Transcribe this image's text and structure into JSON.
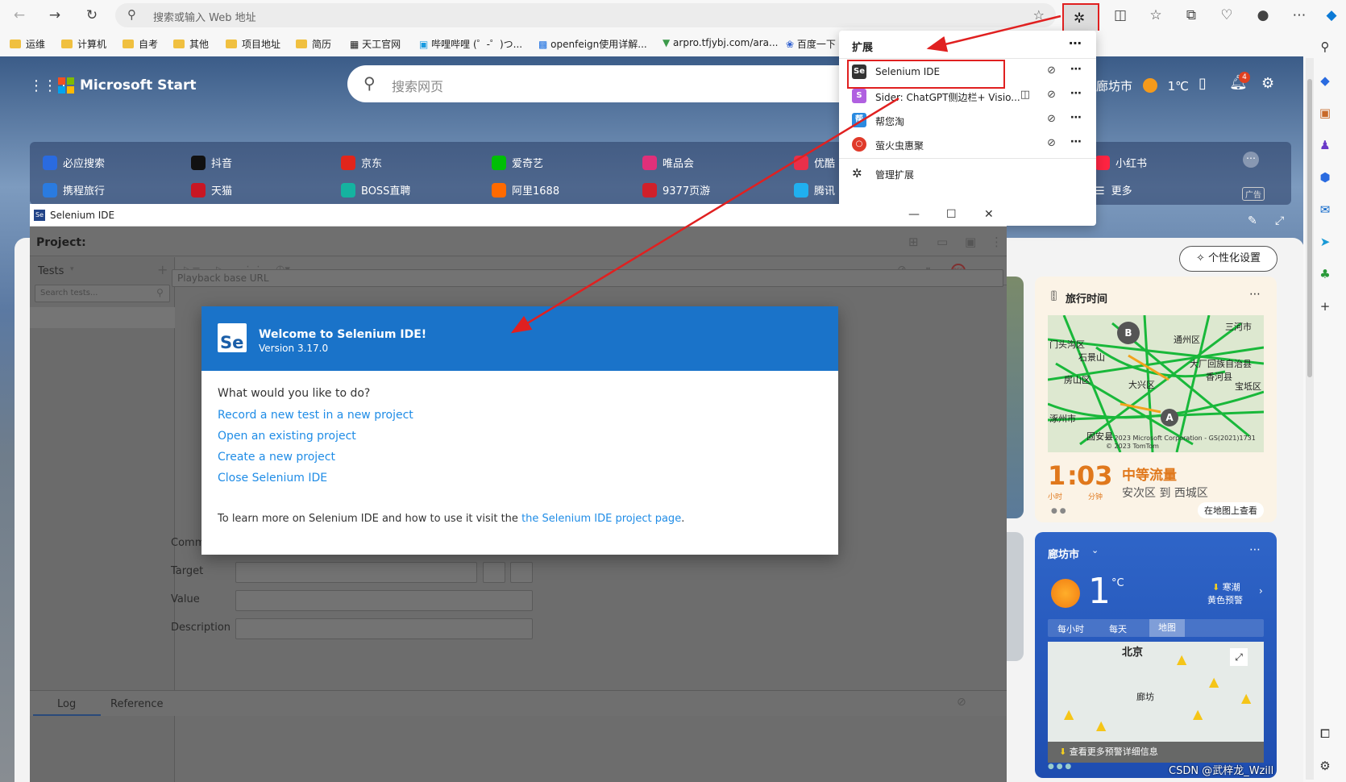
{
  "browser": {
    "address_placeholder": "搜索或输入 Web 地址",
    "bookmarks": [
      "运维",
      "计算机",
      "自考",
      "其他",
      "项目地址",
      "简历",
      "天工官网",
      "哔哩哔哩 (゜-゜)つ...",
      "openfeign使用详解...",
      "arpro.tfjybj.com/ara...",
      "百度一下"
    ],
    "page_title_logo": "Microsoft Start",
    "page_search_placeholder": "搜索网页",
    "location_text": "廊坊市",
    "temp_top": "1℃",
    "notif_count": "4"
  },
  "quick_links": {
    "row1": [
      "必应搜索",
      "抖音",
      "京东",
      "爱奇艺",
      "唯品会",
      "优酷",
      "小红书"
    ],
    "row2": [
      "携程旅行",
      "天猫",
      "BOSS直聘",
      "阿里1688",
      "9377页游",
      "腾讯",
      "更多"
    ],
    "ad_label": "广告"
  },
  "extensions": {
    "header": "扩展",
    "items": [
      "Selenium IDE",
      "Sider: ChatGPT侧边栏+ Visio...",
      "帮您淘",
      "萤火虫惠聚"
    ],
    "manage": "管理扩展"
  },
  "selenium": {
    "window_title": "Selenium IDE",
    "project_label": "Project:",
    "tests_label": "Tests",
    "search_tests_placeholder": "Search tests...",
    "playback_placeholder": "Playback base URL",
    "fields": [
      "Command",
      "Target",
      "Value",
      "Description"
    ],
    "tabs": [
      "Log",
      "Reference"
    ]
  },
  "dialog": {
    "logo": "Se",
    "title": "Welcome to Selenium IDE!",
    "version": "Version 3.17.0",
    "question": "What would you like to do?",
    "links": [
      "Record a new test in a new project",
      "Open an existing project",
      "Create a new project",
      "Close Selenium IDE"
    ],
    "foot_text": "To learn more on Selenium IDE and how to use it visit the ",
    "foot_link": "the Selenium IDE project page",
    "foot_end": "."
  },
  "cards": {
    "personalize": "个性化设置",
    "travel_title": "旅行时间",
    "map_labels": [
      "门头沟区",
      "石景山",
      "通州区",
      "三河市",
      "房山区",
      "大兴区",
      "香河县",
      "大厂回族自治县",
      "宝坻区",
      "涿州市",
      "固安县",
      "B",
      "A"
    ],
    "map_copyright": "© 2023 Microsoft Corporation - GS(2021)1731 © 2023 TomTom",
    "travel_hours": "1",
    "travel_minutes": "03",
    "hour_unit": "小时",
    "minute_unit": "分钟",
    "traffic_status": "中等流量",
    "route": "安次区 到 西城区",
    "map_button": "在地图上查看",
    "weather_city": "廊坊市",
    "weather_temp": "1",
    "weather_unit": "°C",
    "alert1": "寒潮",
    "alert2": "黄色预警",
    "weather_tabs": [
      "每小时",
      "每天",
      "地图"
    ],
    "weather_map_labels": [
      "北京",
      "廊坊"
    ],
    "alert_more": "查看更多预警详细信息",
    "watermark": "CSDN @武梓龙_Wzill"
  },
  "colors": {
    "accent": "#1a73c9",
    "link": "#1f8ce6",
    "annotation": "#e02020"
  }
}
